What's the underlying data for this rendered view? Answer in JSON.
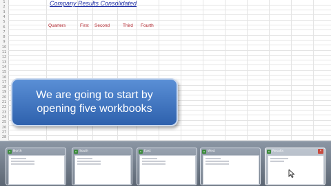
{
  "sheet": {
    "row_numbers": [
      "1",
      "2",
      "3",
      "4",
      "5",
      "6",
      "7",
      "8",
      "9",
      "10",
      "11",
      "12",
      "13",
      "14",
      "15",
      "16",
      "17",
      "18",
      "19",
      "20",
      "21",
      "22",
      "23",
      "24",
      "25",
      "26",
      "27",
      "28"
    ],
    "title": "Company Results Consolidated",
    "header_row": [
      "Quarters",
      "First",
      "Second",
      "Third",
      "Fourth"
    ]
  },
  "banner": {
    "line1": "We are going to start by",
    "line2": "opening five workbooks"
  },
  "taskbar": {
    "thumbnails": [
      {
        "title": "North",
        "active": false
      },
      {
        "title": "South",
        "active": false
      },
      {
        "title": "East",
        "active": false
      },
      {
        "title": "West",
        "active": false
      },
      {
        "title": "Results",
        "active": true
      }
    ],
    "icon": "excel-icon",
    "close_icon": "close-icon"
  },
  "colors": {
    "title": "#1f2fa6",
    "header_text": "#b3232b",
    "banner_top": "#5a8fd6",
    "banner_bottom": "#2e61ad",
    "taskbar": "#6d7785"
  }
}
